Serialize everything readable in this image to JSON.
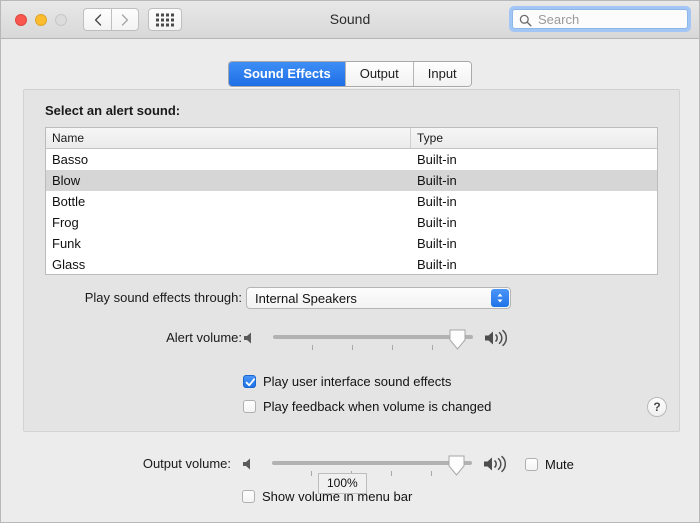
{
  "window": {
    "title": "Sound",
    "traffic_lights": [
      "close",
      "minimize",
      "zoom"
    ]
  },
  "toolbar": {
    "back_icon": "chevron-left-icon",
    "forward_icon": "chevron-right-icon",
    "grid_icon": "show-all-grid-icon",
    "search": {
      "placeholder": "Search",
      "value": "",
      "icon": "search-icon"
    }
  },
  "tabs": [
    {
      "label": "Sound Effects",
      "active": true
    },
    {
      "label": "Output",
      "active": false
    },
    {
      "label": "Input",
      "active": false
    }
  ],
  "sound_effects": {
    "select_label": "Select an alert sound:",
    "table": {
      "columns": [
        "Name",
        "Type"
      ],
      "rows": [
        {
          "name": "Basso",
          "type": "Built-in",
          "selected": false
        },
        {
          "name": "Blow",
          "type": "Built-in",
          "selected": true
        },
        {
          "name": "Bottle",
          "type": "Built-in",
          "selected": false
        },
        {
          "name": "Frog",
          "type": "Built-in",
          "selected": false
        },
        {
          "name": "Funk",
          "type": "Built-in",
          "selected": false
        },
        {
          "name": "Glass",
          "type": "Built-in",
          "selected": false
        }
      ]
    },
    "play_through": {
      "label": "Play sound effects through:",
      "value": "Internal Speakers",
      "options": [
        "Internal Speakers"
      ]
    },
    "alert_volume": {
      "label": "Alert volume:",
      "value_percent": 92,
      "mute_icon": "speaker-muted-icon",
      "loud_icon": "speaker-loud-icon",
      "tick_count": 4
    },
    "checkboxes": [
      {
        "label": "Play user interface sound effects",
        "checked": true
      },
      {
        "label": "Play feedback when volume is changed",
        "checked": false
      }
    ],
    "help_label": "?"
  },
  "output_section": {
    "output_volume": {
      "label": "Output volume:",
      "value_percent": 92,
      "mute_icon": "speaker-muted-icon",
      "loud_icon": "speaker-loud-icon",
      "tick_count": 4
    },
    "mute": {
      "label": "Mute",
      "checked": false
    },
    "show_in_menu_bar": {
      "label": "Show volume in menu bar",
      "checked": false
    },
    "tooltip": "100%"
  },
  "colors": {
    "accent_blue": "#1f73e8",
    "tab_active": "#2b7cee",
    "window_bg": "#ececec",
    "group_bg": "#e4e4e4",
    "selection_gray": "#d6d6d6"
  }
}
